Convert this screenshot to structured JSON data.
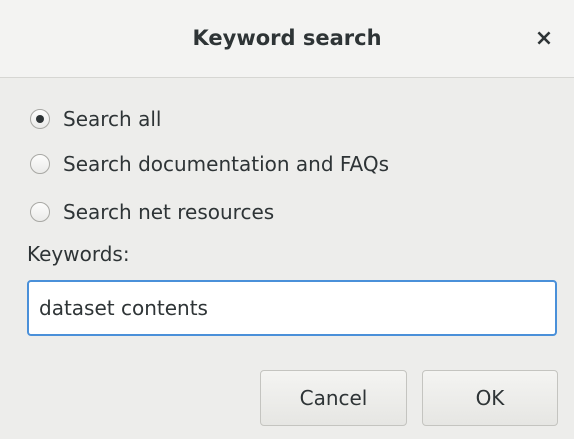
{
  "dialog": {
    "title": "Keyword search",
    "close_icon": "close-icon",
    "close_glyph": "×"
  },
  "options": [
    {
      "label": "Search all",
      "selected": true
    },
    {
      "label": "Search documentation and FAQs",
      "selected": false
    },
    {
      "label": "Search net resources",
      "selected": false
    }
  ],
  "keywords": {
    "label": "Keywords:",
    "value": "dataset contents"
  },
  "buttons": {
    "cancel_label": "Cancel",
    "ok_label": "OK"
  },
  "colors": {
    "focus_border": "#4a90d9",
    "background": "#ededeb"
  }
}
